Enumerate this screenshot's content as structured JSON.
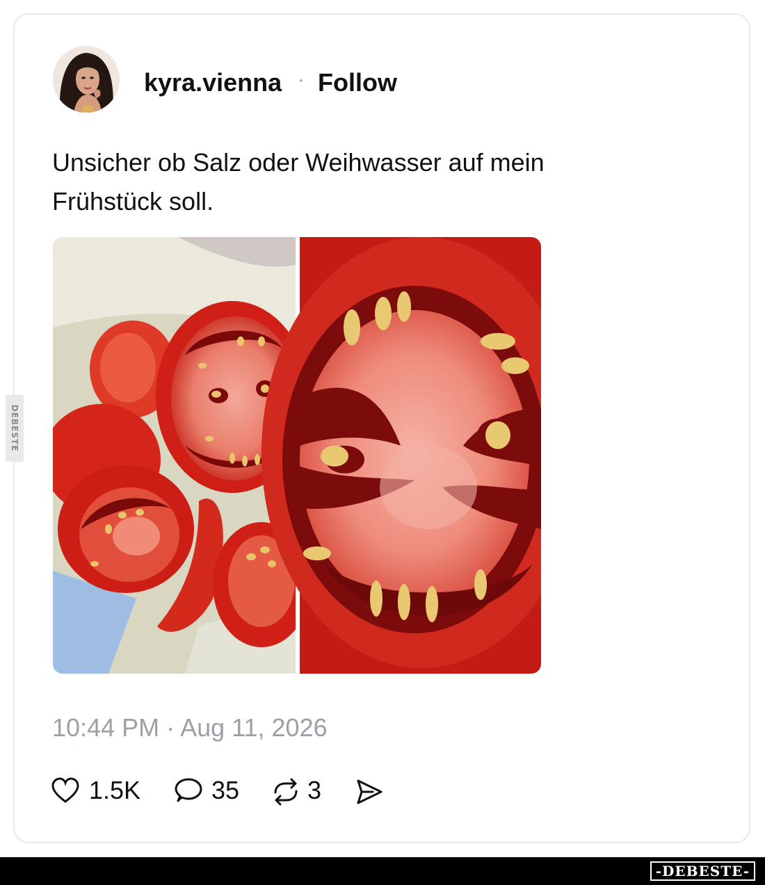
{
  "post": {
    "username": "kyra.vienna",
    "separator": "·",
    "follow_label": "Follow",
    "text": "Unsicher ob Salz oder Weihwasser auf mein Frühstück soll.",
    "timestamp": "10:44 PM · Aug 11, 2026",
    "actions": {
      "like_icon": "heart-icon",
      "like_count": "1.5K",
      "reply_icon": "speech-bubble-icon",
      "reply_count": "35",
      "repost_icon": "repost-icon",
      "repost_count": "3",
      "share_icon": "send-icon"
    }
  },
  "watermark": {
    "side_tag": "DEBESTE",
    "brand": "-DEBESTE-"
  },
  "colors": {
    "border": "#e6e8ea",
    "text": "#111111",
    "muted": "#9aa0a6",
    "tomato": "#d8281e"
  }
}
